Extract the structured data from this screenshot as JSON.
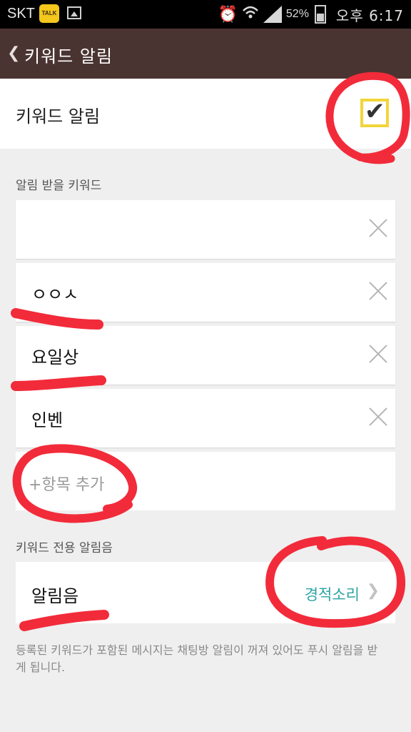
{
  "status_bar": {
    "carrier": "SKT",
    "talk_badge": "TALK",
    "battery_percent": "52%",
    "battery_level": 0.52,
    "time": "오후 6:17",
    "icons": [
      "kakaotalk-icon",
      "image-icon",
      "alarm-icon",
      "wifi-icon",
      "signal-icon",
      "battery-icon"
    ]
  },
  "title_bar": {
    "back_glyph": "❮",
    "title": "키워드 알림"
  },
  "keyword_alert": {
    "label": "키워드 알림",
    "checked": true,
    "check_glyph": "✔"
  },
  "keywords_section": {
    "label": "알림 받을 키워드",
    "items": [
      {
        "text": ""
      },
      {
        "text": "ㅇㅇㅅ"
      },
      {
        "text": "요일상"
      },
      {
        "text": "인벤"
      }
    ],
    "add_label": "+항목 추가"
  },
  "sound_section": {
    "label": "키워드 전용 알림음",
    "row_label": "알림음",
    "value": "경적소리",
    "chevron": "❯"
  },
  "footnote": "등록된 키워드가 포함된 메시지는 채팅방 알림이 꺼져 있어도 푸시 알림을 받게 됩니다.",
  "colors": {
    "title_bar": "#4a3431",
    "checkbox_border": "#f2d63a",
    "accent_value": "#2ba3a3",
    "annotation_red": "#f22b3a"
  }
}
